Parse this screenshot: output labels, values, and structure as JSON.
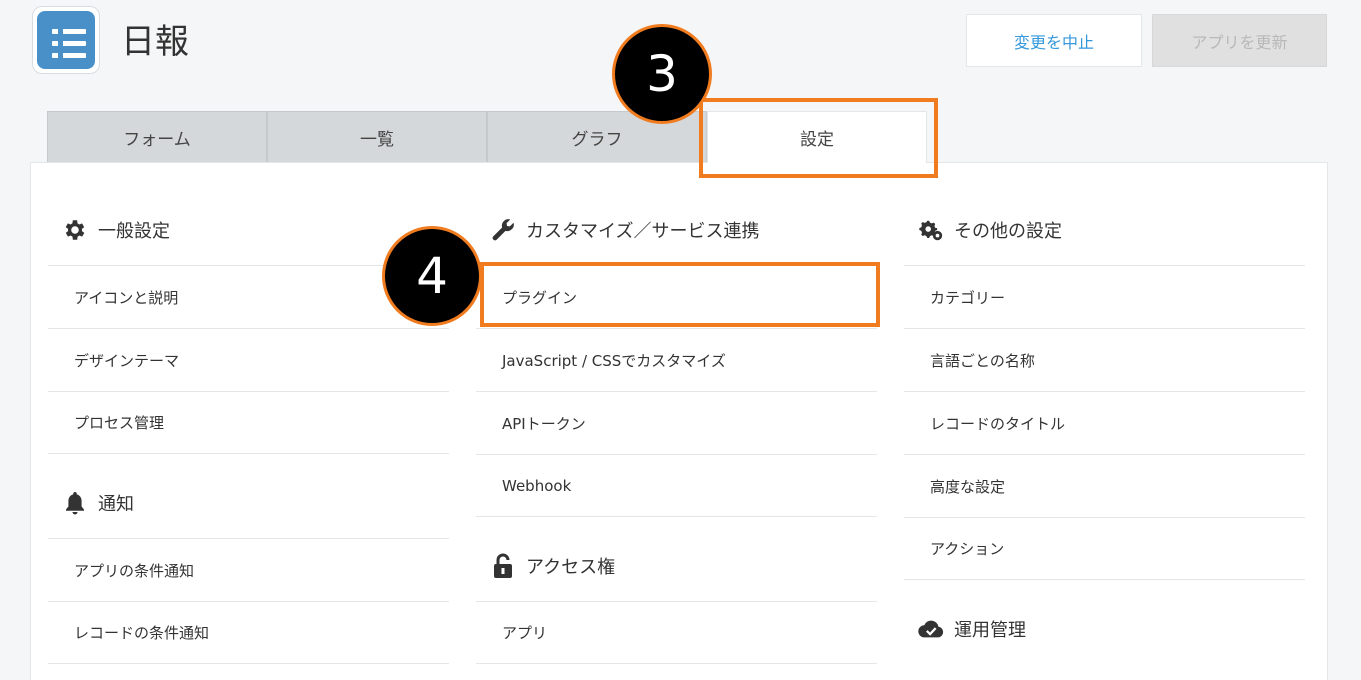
{
  "header": {
    "app_title": "日報",
    "cancel_label": "変更を中止",
    "update_label": "アプリを更新"
  },
  "tabs": [
    {
      "label": "フォーム"
    },
    {
      "label": "一覧"
    },
    {
      "label": "グラフ"
    },
    {
      "label": "設定",
      "active": true
    }
  ],
  "sections": {
    "general": {
      "title": "一般設定",
      "icon": "gear-icon",
      "items": [
        "アイコンと説明",
        "デザインテーマ",
        "プロセス管理"
      ]
    },
    "notification": {
      "title": "通知",
      "icon": "bell-icon",
      "items": [
        "アプリの条件通知",
        "レコードの条件通知"
      ]
    },
    "customize": {
      "title": "カスタマイズ／サービス連携",
      "icon": "wrench-icon",
      "items": [
        "プラグイン",
        "JavaScript / CSSでカスタマイズ",
        "APIトークン",
        "Webhook"
      ]
    },
    "access": {
      "title": "アクセス権",
      "icon": "unlock-icon",
      "items": [
        "アプリ"
      ]
    },
    "other": {
      "title": "その他の設定",
      "icon": "gears-icon",
      "items": [
        "カテゴリー",
        "言語ごとの名称",
        "レコードのタイトル",
        "高度な設定",
        "アクション"
      ]
    },
    "operation": {
      "title": "運用管理",
      "icon": "cloud-check-icon",
      "items": []
    }
  },
  "annotations": {
    "step3": "3",
    "step4": "4",
    "highlight_color": "#f07c1f"
  },
  "colors": {
    "accent": "#3498db",
    "app_icon": "#4a90c8"
  }
}
